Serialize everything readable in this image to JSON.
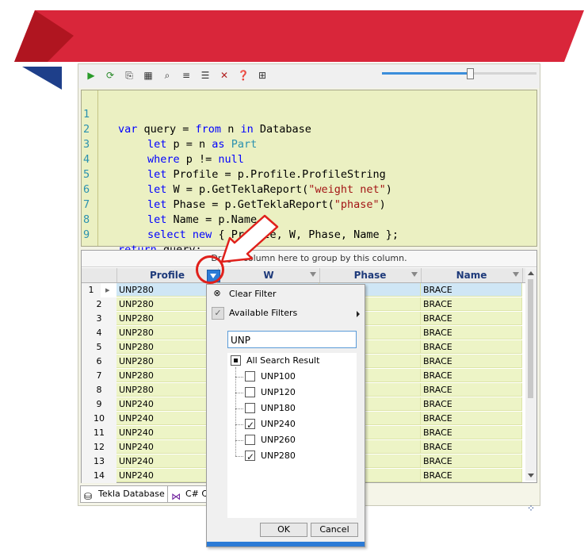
{
  "editor": {
    "lines": [
      {
        "num": "1",
        "text": "var query = from n in Database"
      },
      {
        "num": "2",
        "text": "let p = n as Part"
      },
      {
        "num": "3",
        "text": "where p != null"
      },
      {
        "num": "4",
        "text": "let Profile = p.Profile.ProfileString"
      },
      {
        "num": "5",
        "text": "let W = p.GetTeklaReport(\"weight net\")"
      },
      {
        "num": "6",
        "text": "let Phase = p.GetTeklaReport(\"phase\")"
      },
      {
        "num": "7",
        "text": "let Name = p.Name"
      },
      {
        "num": "8",
        "text": "select new { Profile, W, Phase, Name };"
      },
      {
        "num": "9",
        "text": "return query;"
      }
    ]
  },
  "grid": {
    "group_panel": "Drag a column here to group by this column.",
    "columns": [
      "Profile",
      "W",
      "Phase",
      "Name"
    ],
    "rows": [
      {
        "num": "1",
        "profile": "UNP280",
        "name": "BRACE"
      },
      {
        "num": "2",
        "profile": "UNP280",
        "name": "BRACE"
      },
      {
        "num": "3",
        "profile": "UNP280",
        "name": "BRACE"
      },
      {
        "num": "4",
        "profile": "UNP280",
        "name": "BRACE"
      },
      {
        "num": "5",
        "profile": "UNP280",
        "name": "BRACE"
      },
      {
        "num": "6",
        "profile": "UNP280",
        "name": "BRACE"
      },
      {
        "num": "7",
        "profile": "UNP280",
        "name": "BRACE"
      },
      {
        "num": "8",
        "profile": "UNP280",
        "name": "BRACE"
      },
      {
        "num": "9",
        "profile": "UNP240",
        "name": "BRACE"
      },
      {
        "num": "10",
        "profile": "UNP240",
        "name": "BRACE"
      },
      {
        "num": "11",
        "profile": "UNP240",
        "name": "BRACE"
      },
      {
        "num": "12",
        "profile": "UNP240",
        "name": "BRACE"
      },
      {
        "num": "13",
        "profile": "UNP240",
        "name": "BRACE"
      },
      {
        "num": "14",
        "profile": "UNP240",
        "name": "BRACE"
      }
    ]
  },
  "filter_popup": {
    "clear_filter": "Clear Filter",
    "available_filters": "Available Filters",
    "search_value": "UNP",
    "all_label": "All Search Result",
    "options": [
      {
        "label": "UNP100",
        "checked": false
      },
      {
        "label": "UNP120",
        "checked": false
      },
      {
        "label": "UNP180",
        "checked": false
      },
      {
        "label": "UNP240",
        "checked": true
      },
      {
        "label": "UNP260",
        "checked": false
      },
      {
        "label": "UNP280",
        "checked": true
      }
    ],
    "ok": "OK",
    "cancel": "Cancel"
  },
  "tabs": {
    "tekla": "Tekla Database",
    "csharp": "C# C"
  },
  "zoom_slider_level": 0.57,
  "colors": {
    "banner_red": "#d9263a",
    "banner_dark_red": "#a8111f",
    "banner_blue": "#1e3f8a",
    "editor_bg": "#ebf0c2",
    "callout_red": "#e0201b",
    "accent_blue": "#2c7bd6"
  },
  "icons": [
    "run-icon",
    "refresh-icon",
    "copy-icon",
    "table-icon",
    "find-icon",
    "list-icon",
    "list-check-icon",
    "clear-icon",
    "help-icon",
    "grid-icon"
  ]
}
